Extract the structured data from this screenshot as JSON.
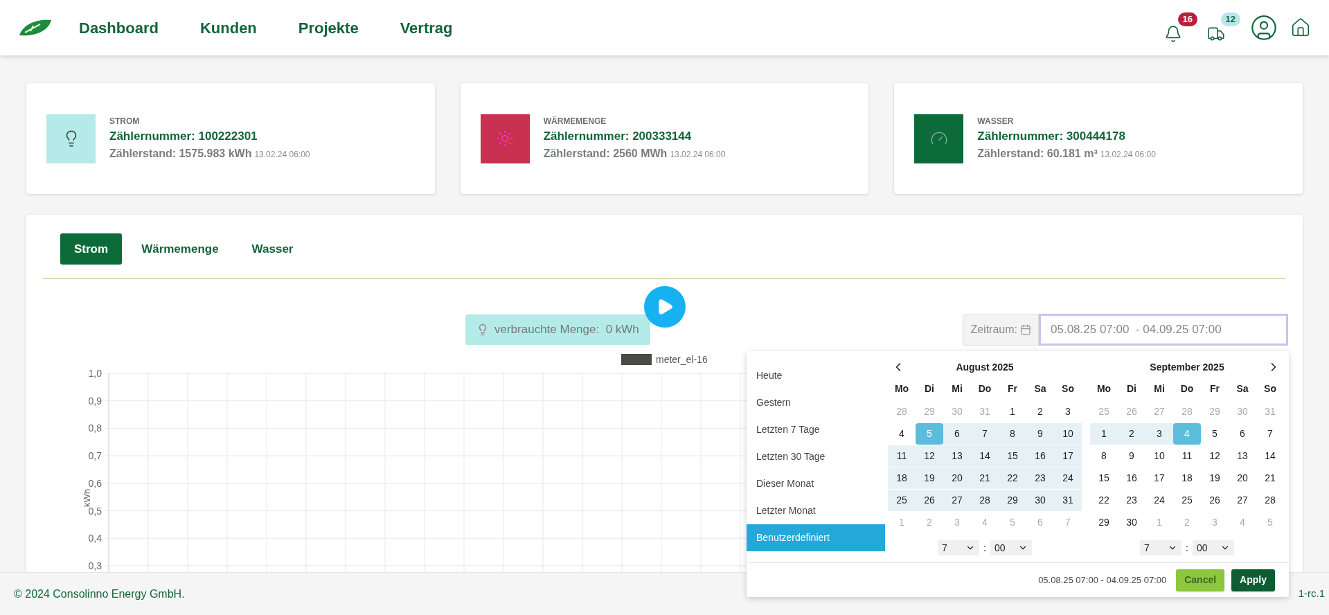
{
  "nav": {
    "items": [
      {
        "label": "Dashboard"
      },
      {
        "label": "Kunden"
      },
      {
        "label": "Projekte"
      },
      {
        "label": "Vertrag"
      }
    ],
    "badges": [
      {
        "kind": "bell",
        "count": "16",
        "color": "#b8203c"
      },
      {
        "kind": "truck",
        "count": "12",
        "color": "#b9e6ec"
      }
    ]
  },
  "meters": [
    {
      "kind": "bulb",
      "color": "#b4ebe8",
      "type": "STROM",
      "number": "Zählernummer: 100222301",
      "reading": "Zählerstand: 1575.983 kWh",
      "time": "13.02.24 06:00"
    },
    {
      "kind": "sun",
      "color": "#c8304f",
      "type": "WÄRMEMENGE",
      "number": "Zählernummer: 200333144",
      "reading": "Zählerstand: 2560 MWh",
      "time": "13.02.24 06:00"
    },
    {
      "kind": "gauge",
      "color": "#0d6b3a",
      "type": "WASSER",
      "number": "Zählernummer: 300444178",
      "reading": "Zählerstand: 60.181 m³",
      "time": "13.02.24 06:00"
    }
  ],
  "tabs": [
    {
      "label": "Strom",
      "selected": true
    },
    {
      "label": "Wärmemenge",
      "selected": false
    },
    {
      "label": "Wasser",
      "selected": false
    }
  ],
  "consumption": "verbrauchte Menge:  0 kWh",
  "period": {
    "label": "Zeitraum:",
    "value": "05.08.25 07:00  - 04.09.25 07:00"
  },
  "chart_data": {
    "type": "bar",
    "ylabel": "kWh",
    "grid": true,
    "ylim": [
      0.3,
      1.0
    ],
    "series": [
      {
        "name": "meter_el-16",
        "color": "#4a4a46"
      }
    ],
    "yticks": [
      {
        "value": 1.0,
        "label": "1,0"
      },
      {
        "value": 0.9,
        "label": "0,9"
      },
      {
        "value": 0.8,
        "label": "0,8"
      },
      {
        "value": 0.7,
        "label": "0,7"
      },
      {
        "value": 0.6,
        "label": "0,6"
      },
      {
        "value": 0.5,
        "label": "0,5"
      },
      {
        "value": 0.4,
        "label": "0,4"
      },
      {
        "value": 0.3,
        "label": "0,3"
      }
    ]
  },
  "picker": {
    "ranges": [
      {
        "label": "Heute",
        "selected": false
      },
      {
        "label": "Gestern",
        "selected": false
      },
      {
        "label": "Letzten 7 Tage",
        "selected": false
      },
      {
        "label": "Letzten 30 Tage",
        "selected": false
      },
      {
        "label": "Dieser Monat",
        "selected": false
      },
      {
        "label": "Letzter Monat",
        "selected": false
      },
      {
        "label": "Benutzerdefiniert",
        "selected": true
      }
    ],
    "months": [
      {
        "title": "August 2025",
        "weekdays": [
          "Mo",
          "Di",
          "Mi",
          "Do",
          "Fr",
          "Sa",
          "So"
        ],
        "weeks": [
          [
            {
              "d": "28",
              "kind": "off"
            },
            {
              "d": "29",
              "kind": "off"
            },
            {
              "d": "30",
              "kind": "off"
            },
            {
              "d": "31",
              "kind": "off"
            },
            {
              "d": "1",
              "kind": "day"
            },
            {
              "d": "2",
              "kind": "day"
            },
            {
              "d": "3",
              "kind": "day"
            }
          ],
          [
            {
              "d": "4",
              "kind": "day"
            },
            {
              "d": "5",
              "kind": "end"
            },
            {
              "d": "6",
              "kind": "range"
            },
            {
              "d": "7",
              "kind": "range"
            },
            {
              "d": "8",
              "kind": "range"
            },
            {
              "d": "9",
              "kind": "range"
            },
            {
              "d": "10",
              "kind": "range"
            }
          ],
          [
            {
              "d": "11",
              "kind": "range"
            },
            {
              "d": "12",
              "kind": "range"
            },
            {
              "d": "13",
              "kind": "range"
            },
            {
              "d": "14",
              "kind": "range"
            },
            {
              "d": "15",
              "kind": "range"
            },
            {
              "d": "16",
              "kind": "range"
            },
            {
              "d": "17",
              "kind": "range"
            }
          ],
          [
            {
              "d": "18",
              "kind": "range"
            },
            {
              "d": "19",
              "kind": "range"
            },
            {
              "d": "20",
              "kind": "range"
            },
            {
              "d": "21",
              "kind": "range"
            },
            {
              "d": "22",
              "kind": "range"
            },
            {
              "d": "23",
              "kind": "range"
            },
            {
              "d": "24",
              "kind": "range"
            }
          ],
          [
            {
              "d": "25",
              "kind": "range"
            },
            {
              "d": "26",
              "kind": "range"
            },
            {
              "d": "27",
              "kind": "range"
            },
            {
              "d": "28",
              "kind": "range"
            },
            {
              "d": "29",
              "kind": "range"
            },
            {
              "d": "30",
              "kind": "range"
            },
            {
              "d": "31",
              "kind": "range"
            }
          ],
          [
            {
              "d": "1",
              "kind": "off"
            },
            {
              "d": "2",
              "kind": "off"
            },
            {
              "d": "3",
              "kind": "off"
            },
            {
              "d": "4",
              "kind": "off"
            },
            {
              "d": "5",
              "kind": "off"
            },
            {
              "d": "6",
              "kind": "off"
            },
            {
              "d": "7",
              "kind": "off"
            }
          ]
        ],
        "hour": "7",
        "separator": ":",
        "minute": "00"
      },
      {
        "title": "September 2025",
        "weekdays": [
          "Mo",
          "Di",
          "Mi",
          "Do",
          "Fr",
          "Sa",
          "So"
        ],
        "weeks": [
          [
            {
              "d": "25",
              "kind": "off"
            },
            {
              "d": "26",
              "kind": "off"
            },
            {
              "d": "27",
              "kind": "off"
            },
            {
              "d": "28",
              "kind": "off"
            },
            {
              "d": "29",
              "kind": "off"
            },
            {
              "d": "30",
              "kind": "off"
            },
            {
              "d": "31",
              "kind": "off"
            }
          ],
          [
            {
              "d": "1",
              "kind": "range"
            },
            {
              "d": "2",
              "kind": "range"
            },
            {
              "d": "3",
              "kind": "range"
            },
            {
              "d": "4",
              "kind": "end"
            },
            {
              "d": "5",
              "kind": "day"
            },
            {
              "d": "6",
              "kind": "day"
            },
            {
              "d": "7",
              "kind": "day"
            }
          ],
          [
            {
              "d": "8",
              "kind": "day"
            },
            {
              "d": "9",
              "kind": "day"
            },
            {
              "d": "10",
              "kind": "day"
            },
            {
              "d": "11",
              "kind": "day"
            },
            {
              "d": "12",
              "kind": "day"
            },
            {
              "d": "13",
              "kind": "day"
            },
            {
              "d": "14",
              "kind": "day"
            }
          ],
          [
            {
              "d": "15",
              "kind": "day"
            },
            {
              "d": "16",
              "kind": "day"
            },
            {
              "d": "17",
              "kind": "day"
            },
            {
              "d": "18",
              "kind": "day"
            },
            {
              "d": "19",
              "kind": "day"
            },
            {
              "d": "20",
              "kind": "day"
            },
            {
              "d": "21",
              "kind": "day"
            }
          ],
          [
            {
              "d": "22",
              "kind": "day"
            },
            {
              "d": "23",
              "kind": "day"
            },
            {
              "d": "24",
              "kind": "day"
            },
            {
              "d": "25",
              "kind": "day"
            },
            {
              "d": "26",
              "kind": "day"
            },
            {
              "d": "27",
              "kind": "day"
            },
            {
              "d": "28",
              "kind": "day"
            }
          ],
          [
            {
              "d": "29",
              "kind": "day"
            },
            {
              "d": "30",
              "kind": "day"
            },
            {
              "d": "1",
              "kind": "off"
            },
            {
              "d": "2",
              "kind": "off"
            },
            {
              "d": "3",
              "kind": "off"
            },
            {
              "d": "4",
              "kind": "off"
            },
            {
              "d": "5",
              "kind": "off"
            }
          ]
        ],
        "hour": "7",
        "separator": ":",
        "minute": "00"
      }
    ],
    "summary": "05.08.25 07:00 - 04.09.25 07:00",
    "buttons": [
      {
        "kind": "cancel",
        "label": "Cancel"
      },
      {
        "kind": "apply",
        "label": "Apply"
      }
    ]
  },
  "footer": {
    "copyright": "© 2024 Consolinno Energy GmbH.",
    "version": "1-rc.1"
  }
}
